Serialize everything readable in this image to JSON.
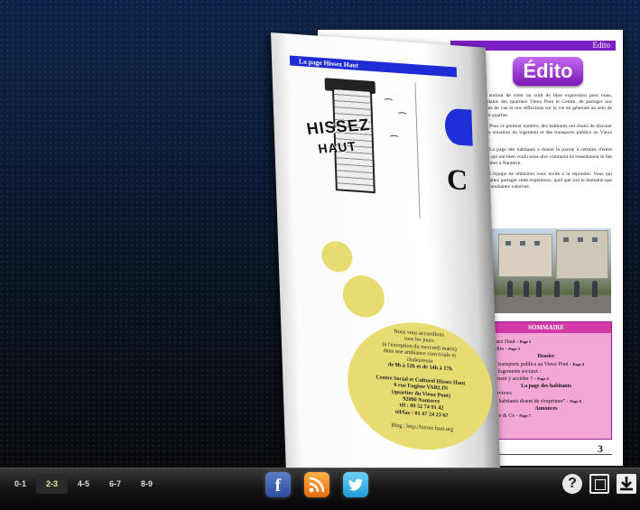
{
  "right_page": {
    "header_bar": "Edito",
    "badge": "Édito",
    "paragraphs": [
      "surtout de créer un outil de libre expression pour nous, habitants des quartiers Vieux Pont et Centre, de partager nos points de vue et nos réflexions sur la vie en générale au sein de notre quartier.",
      "Pour ce premier numéro, des habitants ont choisi de discuter de la situation du logement et des transports publics au Vieux Port.",
      "La page des habitants a donné la parole à certains d'entre nous qui ont bien voulu nous dire comment ils ressentaient le fait d'habiter à Nanterre.",
      "L'équipe de rédaction vous invite à la rejoindre. Vous qui souhaitez partager cette expérience, quel que soit le domaine que vous souhaitez valoriser."
    ],
    "sommaire": {
      "title": "SOMMAIRE",
      "items": [
        {
          "text": "- Hissez Haut - ",
          "page": "Page 2"
        },
        {
          "text": "- L'édito - ",
          "page": "Page 3"
        },
        {
          "text": "Dossier",
          "center": true
        },
        {
          "text": "- Les transports publics au Vieux Pont - ",
          "page": "Page 4"
        },
        {
          "text": "- Les logements sociaux :",
          "page": ""
        },
        {
          "text": "Comment y accéder ? - ",
          "page": "Page 5"
        },
        {
          "text": "La page des habitants",
          "center": true
        },
        {
          "text": "- Interviews",
          "page": ""
        },
        {
          "text": "-\"Les habitants disent de s'exprimer\" - ",
          "page": "Page 6"
        },
        {
          "text": "Annonces",
          "center": true
        },
        {
          "text": "Voiture & Co - ",
          "page": "Page 7"
        }
      ]
    },
    "page_number": "3"
  },
  "flip_page": {
    "header_bar": "La page Hissez Haut",
    "drawing_text_1": "HISSEZ",
    "drawing_text_2": "HAUT",
    "peek_big": "C",
    "circle_lines": [
      "Nous vous accueillons",
      "tous les jours",
      "(à l'exception du mercredi matin)",
      "dans une ambiance conviviale et",
      "chaleureuse",
      "de 9h à 12h et de 14h à 17h",
      "",
      "Centre Social et Culturel Hissez Haut",
      "6 rue Eugène VARLIN",
      "(quartier du Vieux Pont)",
      "92000 Nanterre",
      "tél : 09 52 74 91 42",
      "tél/fax : 01 47 24 23 67",
      "",
      "Blog : http://hissez.haut.org"
    ]
  },
  "toolbar": {
    "pages": [
      "0-1",
      "2-3",
      "4-5",
      "6-7",
      "8-9"
    ],
    "active_page": "2-3",
    "facebook_glyph": "f",
    "help_glyph": "?"
  },
  "colors": {
    "edito_purple": "#7a1fc4",
    "sommaire_pink": "#f2a7d7",
    "flip_blue_bar": "#1f2cd6",
    "circle_yellow": "#e6dc72"
  }
}
